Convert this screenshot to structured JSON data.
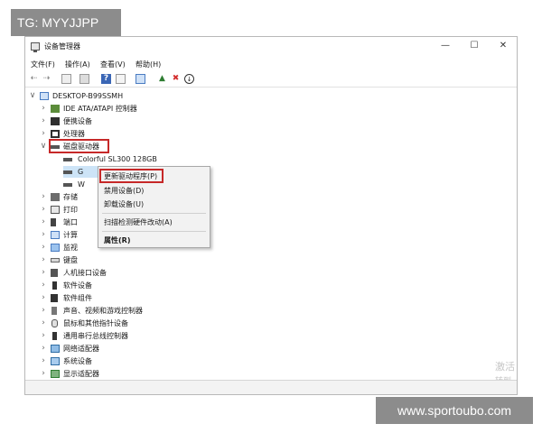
{
  "watermark_top": "TG: MYYJJPP",
  "watermark_bottom": "www.sportoubo.com",
  "window": {
    "title": "设备管理器",
    "min_icon": "minimize-icon",
    "max_icon": "maximize-icon",
    "close_icon": "close-icon"
  },
  "menu": [
    "文件(F)",
    "操作(A)",
    "查看(V)",
    "帮助(H)"
  ],
  "toolbar_icons": [
    "back-arrow-icon",
    "forward-arrow-icon",
    "properties-icon",
    "show-hidden-icon",
    "help-icon",
    "view-icon",
    "monitor-icon",
    "add-driver-icon",
    "uninstall-icon",
    "update-driver-icon"
  ],
  "tree": {
    "root": "DESKTOP-B99SSMH",
    "categories": [
      "IDE ATA/ATAPI 控制器",
      "便携设备",
      "处理器",
      "磁盘驱动器"
    ],
    "disk_children": [
      "Colorful SL300 128GB",
      "G",
      "W"
    ],
    "after_disk": [
      "存储",
      "打印",
      "端口",
      "计算",
      "监视",
      "键盘",
      "人机接口设备",
      "软件设备",
      "软件组件",
      "声音、视频和游戏控制器",
      "鼠标和其他指针设备",
      "通用串行总线控制器",
      "网络适配器",
      "系统设备",
      "显示适配器"
    ]
  },
  "context_menu": {
    "items": [
      "更新驱动程序(P)",
      "禁用设备(D)",
      "卸载设备(U)",
      "扫描检测硬件改动(A)",
      "属性(R)"
    ]
  },
  "activation_text": [
    "激活",
    "转到"
  ],
  "colors": {
    "highlight_box": "#c62828",
    "watermark_bg": "#8c8c8c"
  }
}
